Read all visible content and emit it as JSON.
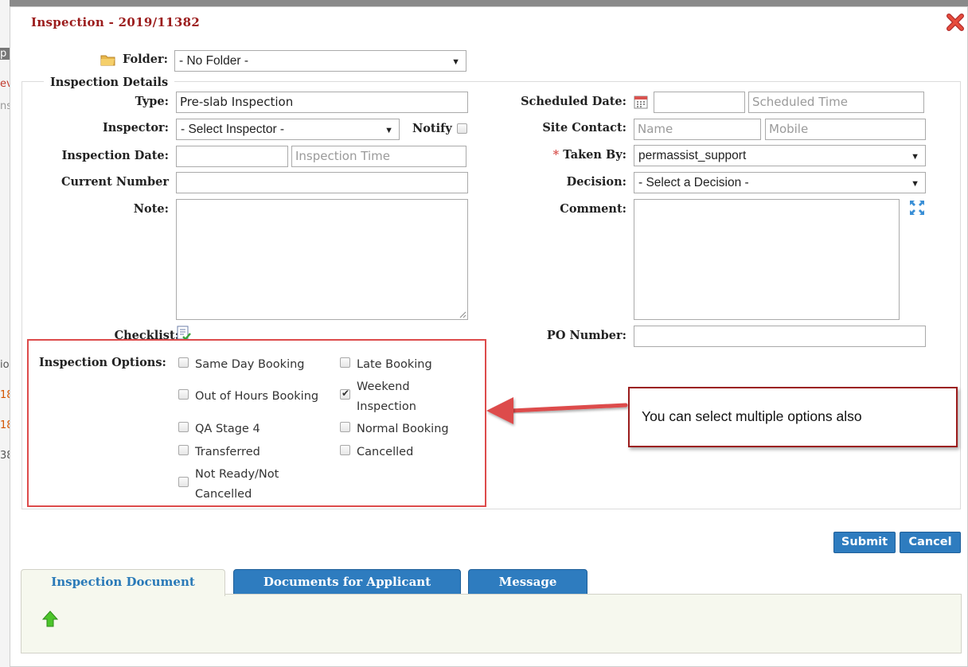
{
  "background": {
    "fragments": [
      "p",
      "ev",
      "ns",
      "io",
      "18",
      "18",
      "38"
    ]
  },
  "dialog": {
    "title": "Inspection - 2019/11382"
  },
  "folder": {
    "label": "Folder:",
    "value": "- No Folder -"
  },
  "details": {
    "legend": "Inspection Details",
    "type_label": "Type:",
    "type_value": "Pre-slab Inspection",
    "inspector_label": "Inspector:",
    "inspector_value": "- Select Inspector -",
    "notify_label": "Notify",
    "inspection_date_label": "Inspection Date:",
    "inspection_date_value": "",
    "inspection_time_placeholder": "Inspection Time",
    "current_number_label": "Current Number",
    "current_number_value": "",
    "note_label": "Note:",
    "checklist_label": "Checklist:",
    "scheduled_date_label": "Scheduled Date:",
    "scheduled_date_value": "",
    "scheduled_time_placeholder": "Scheduled Time",
    "site_contact_label": "Site Contact:",
    "site_contact_name_placeholder": "Name",
    "site_contact_mobile_placeholder": "Mobile",
    "required_star": "*",
    "taken_by_label": "Taken By:",
    "taken_by_value": "permassist_support",
    "decision_label": "Decision:",
    "decision_value": "- Select a Decision -",
    "comment_label": "Comment:",
    "po_number_label": "PO Number:",
    "po_number_value": ""
  },
  "options": {
    "label": "Inspection Options:",
    "items": [
      {
        "label": "Same Day Booking",
        "checked": false
      },
      {
        "label": "Late Booking",
        "checked": false
      },
      {
        "label": "Out of Hours Booking",
        "checked": false
      },
      {
        "label": "Weekend Inspection",
        "checked": true
      },
      {
        "label": "QA Stage 4",
        "checked": false
      },
      {
        "label": "Normal Booking",
        "checked": false
      },
      {
        "label": "Transferred",
        "checked": false
      },
      {
        "label": "Cancelled",
        "checked": false
      },
      {
        "label": "Not Ready/Not Cancelled",
        "checked": false
      }
    ]
  },
  "annotation": {
    "text": "You can select multiple options also",
    "color": "#dd4b4b"
  },
  "buttons": {
    "submit": "Submit",
    "cancel": "Cancel"
  },
  "tabs": [
    {
      "label": "Inspection Document",
      "active": true
    },
    {
      "label": "Documents for Applicant",
      "active": false
    },
    {
      "label": "Message",
      "active": false
    }
  ],
  "colors": {
    "accent": "#2e7cbf",
    "title": "#9b1c1c",
    "panel": "#f6f8ee"
  },
  "icons": [
    "folder-icon",
    "close-icon",
    "calendar-icon",
    "expand-icon",
    "checklist-icon",
    "upload-arrow-icon",
    "dropdown-arrow-icon"
  ]
}
